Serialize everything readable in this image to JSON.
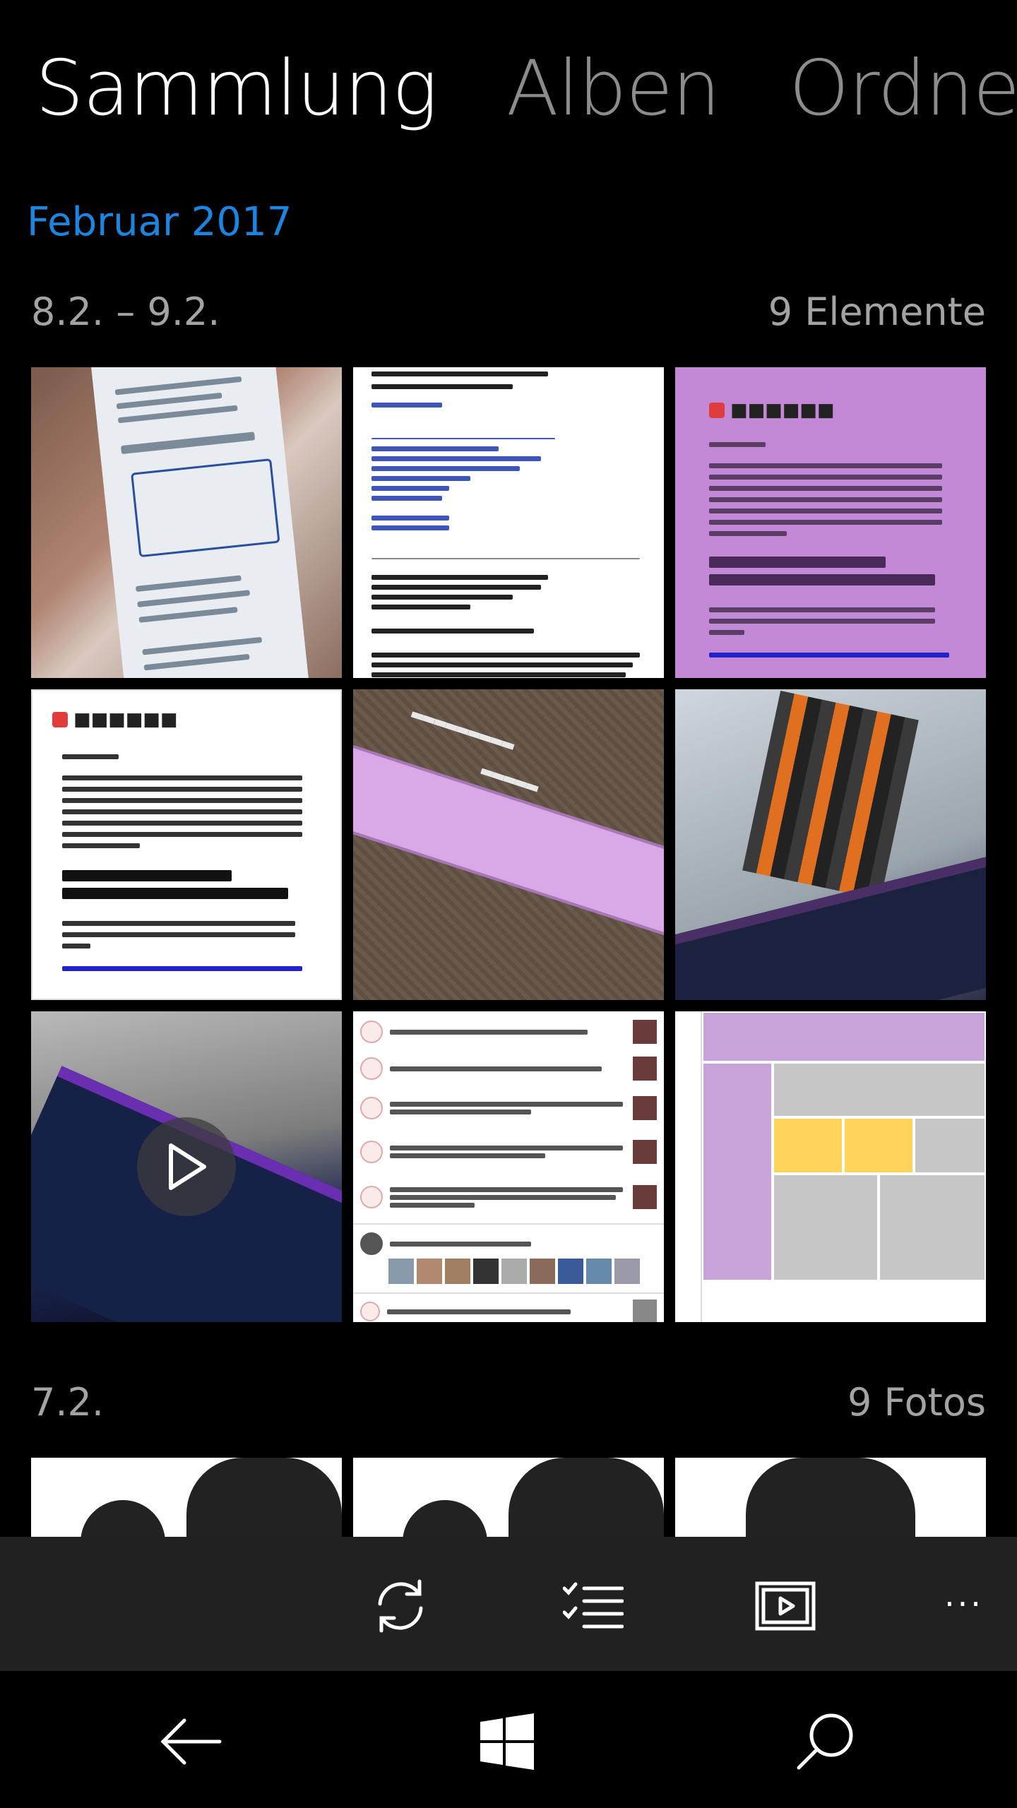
{
  "pivot": {
    "tabs": [
      "Sammlung",
      "Alben",
      "Ordner"
    ],
    "active_index": 0
  },
  "collection": {
    "month": "Februar 2017",
    "groups": [
      {
        "date": "8.2. – 9.2.",
        "count": "9 Elemente"
      },
      {
        "date": "7.2.",
        "count": "9 Fotos"
      }
    ]
  },
  "app_bar": {
    "icons": [
      "sync-icon",
      "select-icon",
      "slideshow-icon"
    ],
    "more": "···"
  },
  "nav_bar": {
    "icons": [
      "back-icon",
      "windows-start-icon",
      "search-icon"
    ]
  },
  "colors": {
    "accent": "#1a86e0",
    "background": "#000000",
    "app_bar": "#212121"
  }
}
